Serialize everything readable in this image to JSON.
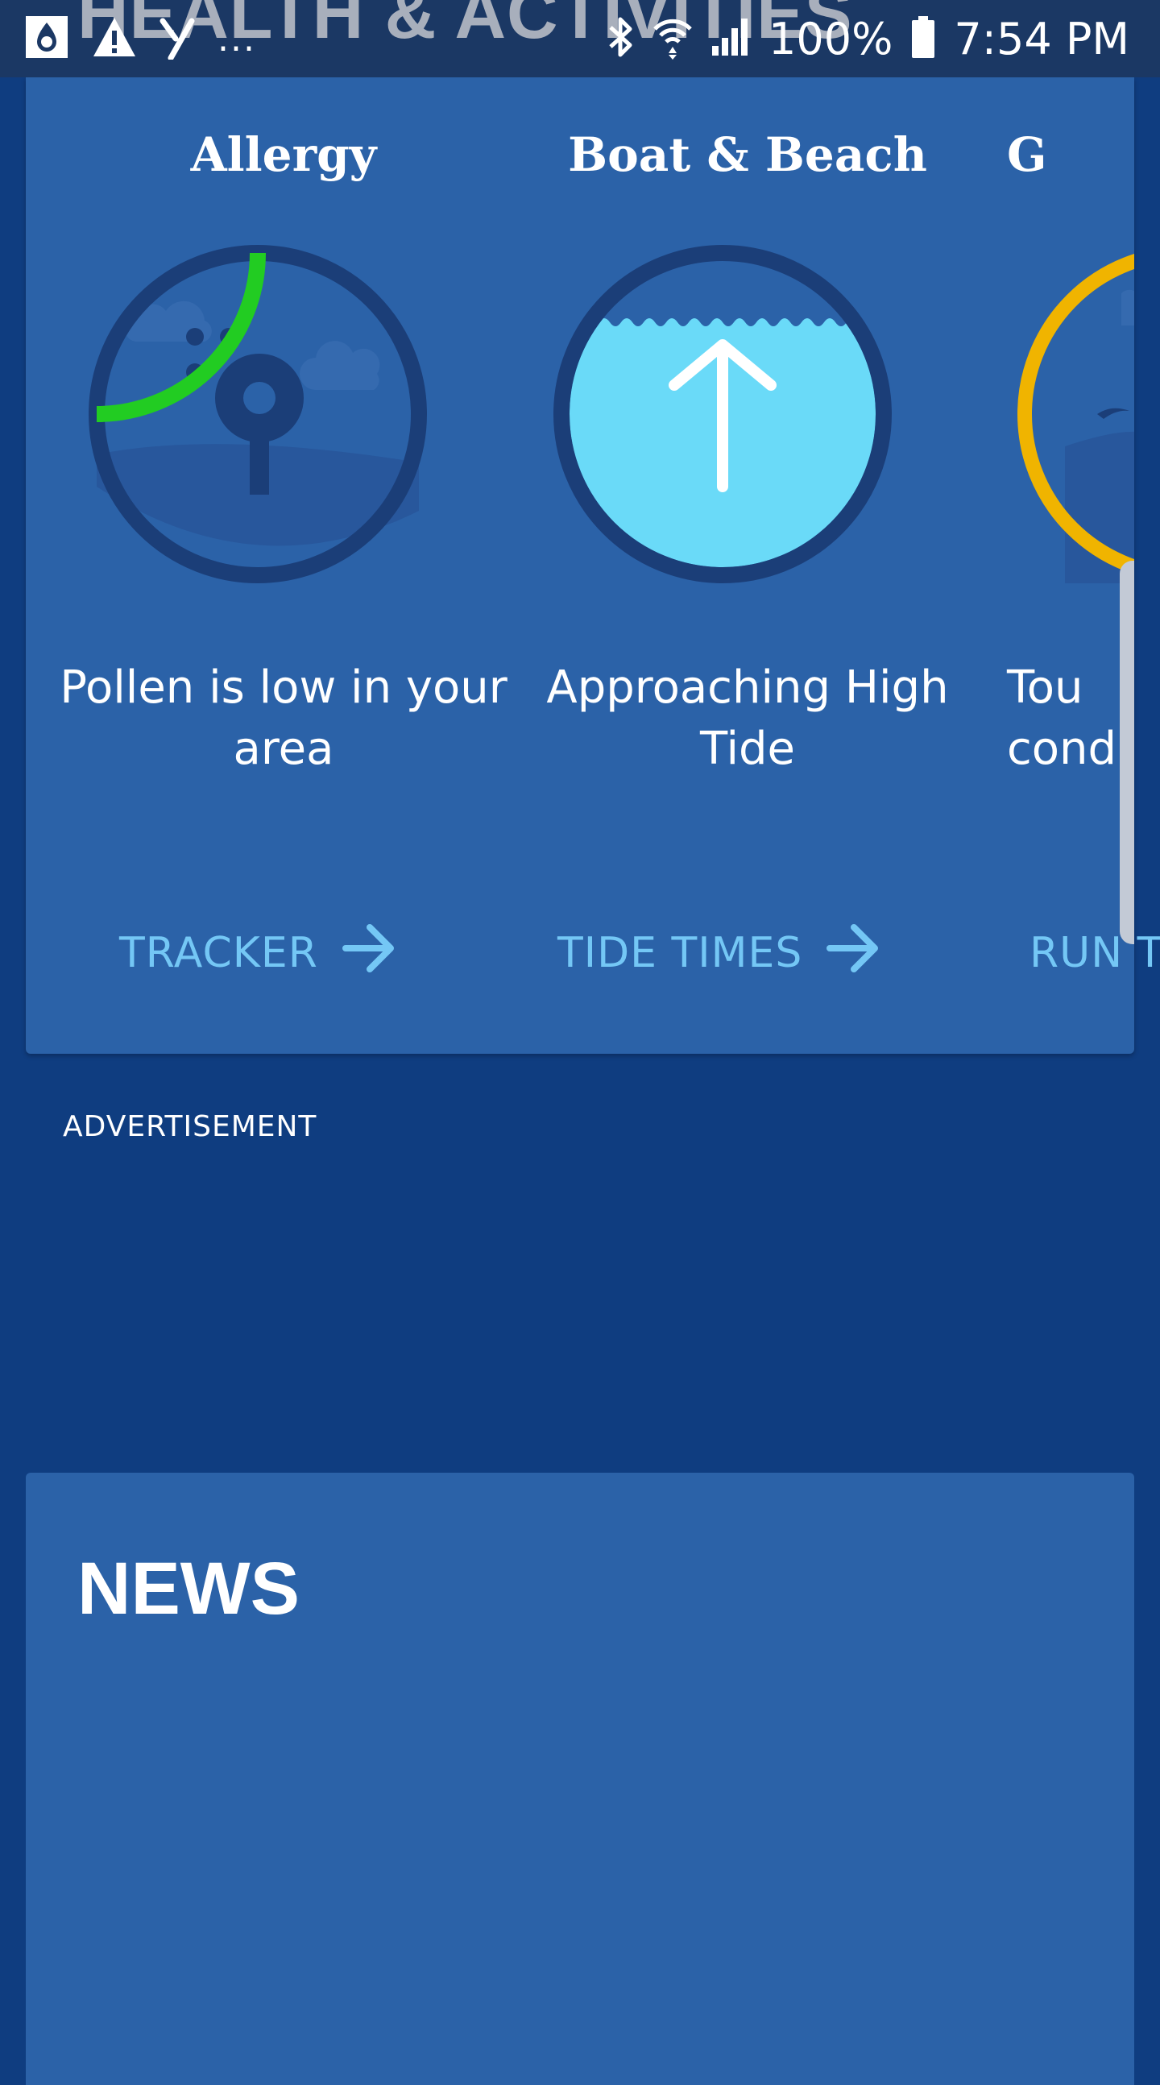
{
  "status_bar": {
    "section_title": "HEALTH & ACTIVITIES",
    "notification_icons": [
      "app-drop-icon",
      "warning-icon",
      "yahoo-icon"
    ],
    "overflow": "...",
    "battery": "100%",
    "time": "7:54 PM"
  },
  "activities": [
    {
      "title": "Allergy",
      "description": "Pollen is low in your area",
      "link": "TRACKER",
      "gauge_level": 0.25,
      "gauge_color": "#22cc22"
    },
    {
      "title": "Boat & Beach",
      "description": "Approaching High Tide",
      "link": "TIDE TIMES",
      "tide_level": 0.8,
      "water_color": "#6adaf8"
    },
    {
      "title": "G",
      "description": "Tou condi",
      "link": "RUN T",
      "gauge_color": "#f0b400"
    }
  ],
  "advertisement_label": "ADVERTISEMENT",
  "news": {
    "title": "NEWS"
  },
  "colors": {
    "background": "#0f3d80",
    "card": "#2b62a8",
    "ring": "#1b3e78",
    "link": "#74c7f5"
  }
}
